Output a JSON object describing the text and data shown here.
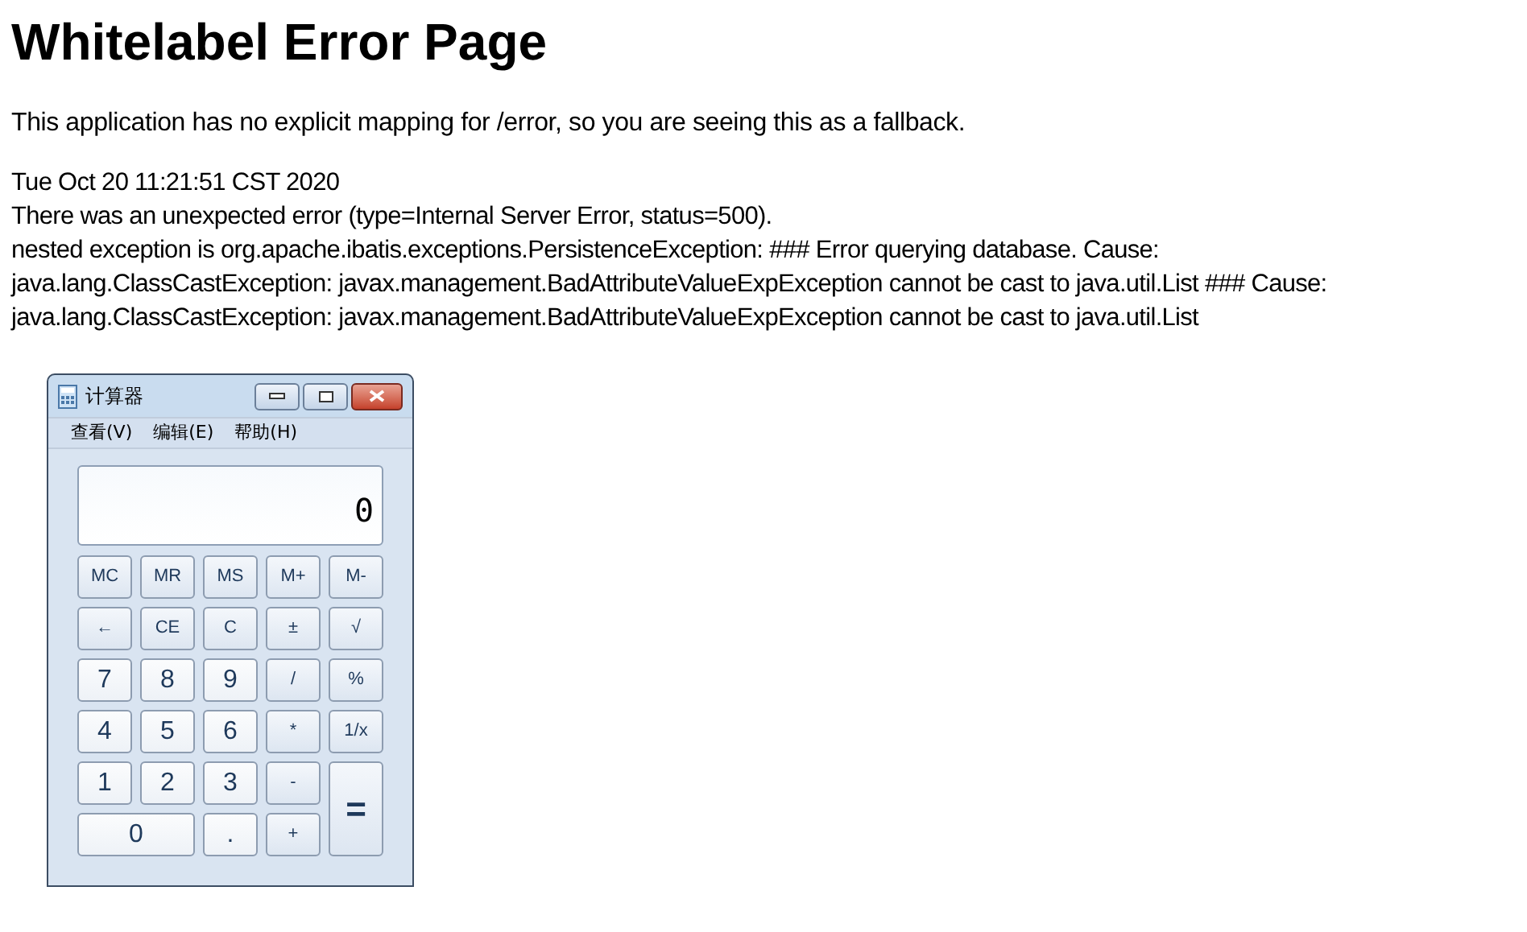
{
  "page": {
    "title": "Whitelabel Error Page",
    "intro": "This application has no explicit mapping for /error, so you are seeing this as a fallback.",
    "details": [
      "Tue Oct 20 11:21:51 CST 2020",
      "There was an unexpected error (type=Internal Server Error, status=500).",
      "nested exception is org.apache.ibatis.exceptions.PersistenceException: ### Error querying database. Cause:",
      "java.lang.ClassCastException: javax.management.BadAttributeValueExpException cannot be cast to java.util.List ### Cause:",
      "java.lang.ClassCastException: javax.management.BadAttributeValueExpException cannot be cast to java.util.List"
    ]
  },
  "calculator": {
    "title": "计算器",
    "menu": [
      "查看(V)",
      "编辑(E)",
      "帮助(H)"
    ],
    "display": "0",
    "keys": [
      {
        "label": "MC",
        "kind": "key"
      },
      {
        "label": "MR",
        "kind": "key"
      },
      {
        "label": "MS",
        "kind": "key"
      },
      {
        "label": "M+",
        "kind": "key"
      },
      {
        "label": "M-",
        "kind": "key"
      },
      {
        "label": "←",
        "kind": "key"
      },
      {
        "label": "CE",
        "kind": "key"
      },
      {
        "label": "C",
        "kind": "key"
      },
      {
        "label": "±",
        "kind": "key"
      },
      {
        "label": "√",
        "kind": "key"
      },
      {
        "label": "7",
        "kind": "digit"
      },
      {
        "label": "8",
        "kind": "digit"
      },
      {
        "label": "9",
        "kind": "digit"
      },
      {
        "label": "/",
        "kind": "key"
      },
      {
        "label": "%",
        "kind": "key"
      },
      {
        "label": "4",
        "kind": "digit"
      },
      {
        "label": "5",
        "kind": "digit"
      },
      {
        "label": "6",
        "kind": "digit"
      },
      {
        "label": "*",
        "kind": "key"
      },
      {
        "label": "1/x",
        "kind": "key"
      },
      {
        "label": "1",
        "kind": "digit"
      },
      {
        "label": "2",
        "kind": "digit"
      },
      {
        "label": "3",
        "kind": "digit"
      },
      {
        "label": "-",
        "kind": "key"
      },
      {
        "label": "=",
        "kind": "tall"
      },
      {
        "label": "0",
        "kind": "wide"
      },
      {
        "label": ".",
        "kind": "digit"
      },
      {
        "label": "+",
        "kind": "key"
      }
    ]
  }
}
